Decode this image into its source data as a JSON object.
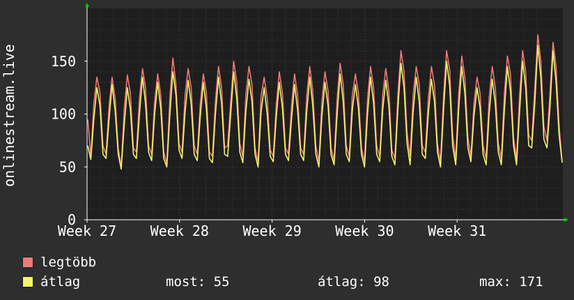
{
  "chart_data": {
    "type": "line",
    "title": "",
    "ylabel": "onlinestream.live",
    "xlabel": "",
    "x_tick_labels": [
      "Week 27",
      "Week 28",
      "Week 29",
      "Week 30",
      "Week 31"
    ],
    "ylim": [
      0,
      200
    ],
    "y_ticks": [
      0,
      50,
      100,
      150
    ],
    "grid": true,
    "samples_per_day": 6,
    "series": [
      {
        "name": "legtöbb",
        "color": "#f07a7a",
        "values": [
          95,
          60,
          110,
          135,
          120,
          70,
          62,
          108,
          135,
          115,
          68,
          50,
          105,
          137,
          120,
          68,
          64,
          115,
          143,
          125,
          70,
          62,
          112,
          138,
          118,
          64,
          53,
          116,
          153,
          128,
          72,
          64,
          118,
          143,
          125,
          70,
          62,
          110,
          138,
          120,
          64,
          60,
          113,
          145,
          125,
          68,
          70,
          112,
          150,
          130,
          72,
          60,
          118,
          145,
          128,
          68,
          55,
          117,
          135,
          115,
          66,
          60,
          110,
          140,
          120,
          68,
          62,
          108,
          138,
          118,
          68,
          62,
          117,
          145,
          122,
          70,
          55,
          112,
          140,
          122,
          68,
          56,
          115,
          148,
          128,
          70,
          60,
          118,
          138,
          120,
          68,
          55,
          115,
          145,
          125,
          70,
          60,
          118,
          143,
          122,
          66,
          58,
          120,
          160,
          140,
          82,
          60,
          118,
          145,
          128,
          70,
          64,
          115,
          145,
          128,
          72,
          55,
          118,
          160,
          142,
          80,
          58,
          120,
          155,
          135,
          78,
          60,
          110,
          135,
          120,
          70,
          58,
          115,
          145,
          125,
          72,
          58,
          120,
          155,
          138,
          78,
          58,
          118,
          160,
          140,
          80,
          75,
          125,
          175,
          150,
          88,
          75,
          120,
          168,
          145,
          90,
          55
        ]
      },
      {
        "name": "átlag",
        "color": "#f5f56a",
        "values": [
          70,
          57,
          95,
          125,
          108,
          62,
          58,
          95,
          128,
          103,
          62,
          48,
          90,
          125,
          105,
          62,
          58,
          100,
          135,
          110,
          64,
          56,
          100,
          130,
          105,
          58,
          50,
          100,
          140,
          118,
          66,
          58,
          102,
          132,
          110,
          62,
          56,
          98,
          130,
          105,
          58,
          54,
          100,
          135,
          110,
          62,
          60,
          100,
          140,
          115,
          64,
          54,
          103,
          133,
          112,
          62,
          50,
          102,
          125,
          100,
          60,
          55,
          98,
          130,
          106,
          62,
          56,
          95,
          128,
          104,
          62,
          56,
          102,
          135,
          108,
          62,
          50,
          98,
          130,
          108,
          62,
          52,
          100,
          138,
          112,
          62,
          55,
          104,
          128,
          106,
          62,
          50,
          100,
          135,
          110,
          62,
          55,
          104,
          132,
          108,
          60,
          52,
          106,
          148,
          125,
          72,
          52,
          102,
          135,
          112,
          62,
          58,
          100,
          133,
          112,
          64,
          50,
          104,
          150,
          127,
          70,
          52,
          106,
          145,
          120,
          68,
          55,
          98,
          125,
          106,
          62,
          52,
          100,
          133,
          110,
          64,
          52,
          104,
          145,
          122,
          70,
          52,
          102,
          150,
          125,
          70,
          68,
          110,
          165,
          135,
          76,
          68,
          106,
          160,
          130,
          80,
          54
        ]
      }
    ]
  },
  "legend": {
    "items": [
      {
        "label": "legtöbb",
        "color": "#f07a7a"
      },
      {
        "label": "átlag",
        "color": "#f5f56a"
      }
    ],
    "stats": [
      {
        "text": "most: 55"
      },
      {
        "text": "átlag: 98"
      },
      {
        "text": "max: 171"
      }
    ]
  }
}
